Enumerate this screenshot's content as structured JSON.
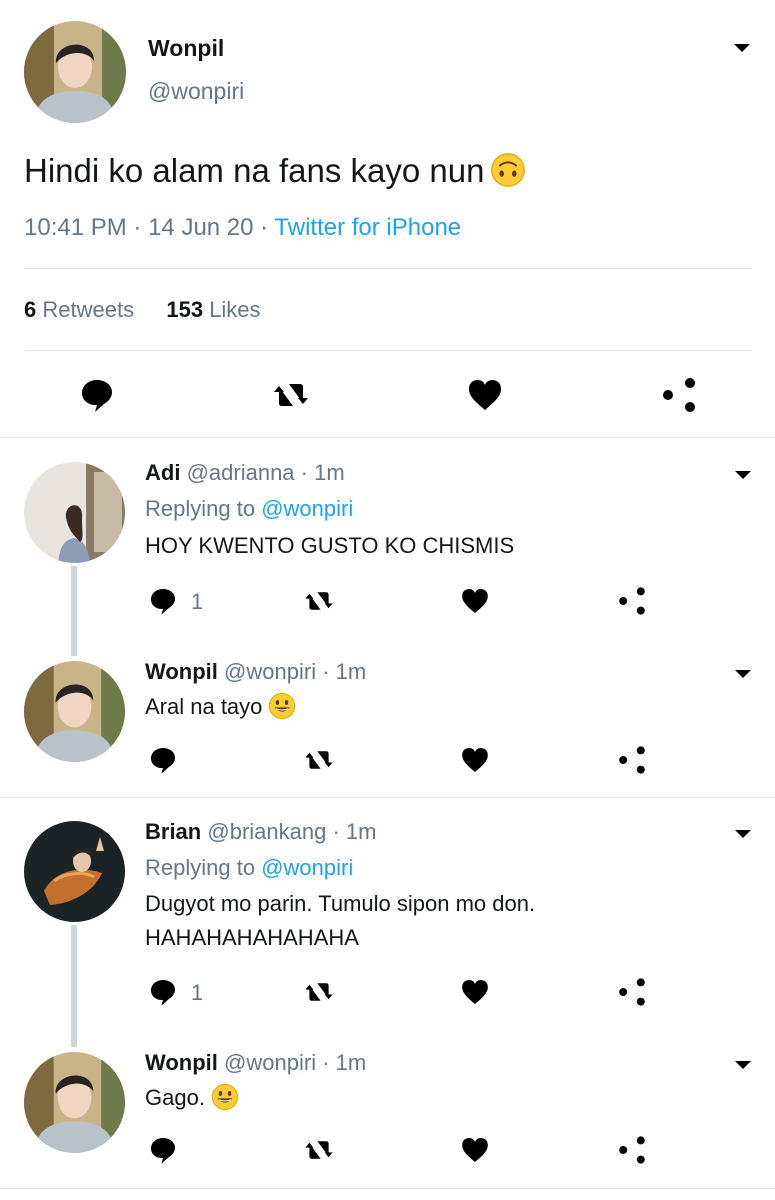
{
  "main_tweet": {
    "name": "Wonpil",
    "handle": "@wonpiri",
    "text": "Hindi ko alam na fans kayo nun",
    "emoji": "upside-down-face",
    "time": "10:41 PM",
    "sep1": "·",
    "date": "14 Jun 20",
    "sep2": "·",
    "source": "Twitter for iPhone",
    "retweets_count": "6",
    "retweets_label": "Retweets",
    "likes_count": "153",
    "likes_label": "Likes"
  },
  "replies": [
    {
      "name": "Adi",
      "handle": "@adrianna",
      "dot": "·",
      "time": "1m",
      "replying_label": "Replying to",
      "replying_to": "@wonpiri",
      "text": "HOY KWENTO GUSTO KO CHISMIS",
      "reply_count": "1"
    },
    {
      "name": "Wonpil",
      "handle": "@wonpiri",
      "dot": "·",
      "time": "1m",
      "text": "Aral na tayo",
      "emoji": "grinning-face"
    },
    {
      "name": "Brian",
      "handle": "@briankang",
      "dot": "·",
      "time": "1m",
      "replying_label": "Replying to",
      "replying_to": "@wonpiri",
      "text_line1": "Dugyot mo parin. Tumulo sipon mo don.",
      "text_line2": "HAHAHAHAHAHAHA",
      "reply_count": "1"
    },
    {
      "name": "Wonpil",
      "handle": "@wonpiri",
      "dot": "·",
      "time": "1m",
      "text": "Gago.",
      "emoji": "grinning-face"
    }
  ],
  "icons": [
    "reply-icon",
    "retweet-icon",
    "like-icon",
    "share-icon",
    "chevron-down-icon"
  ],
  "colors": {
    "link": "#1da1f2",
    "muted": "#657786",
    "divider": "#e1e8ed",
    "thread_line": "#ccd6dd"
  }
}
